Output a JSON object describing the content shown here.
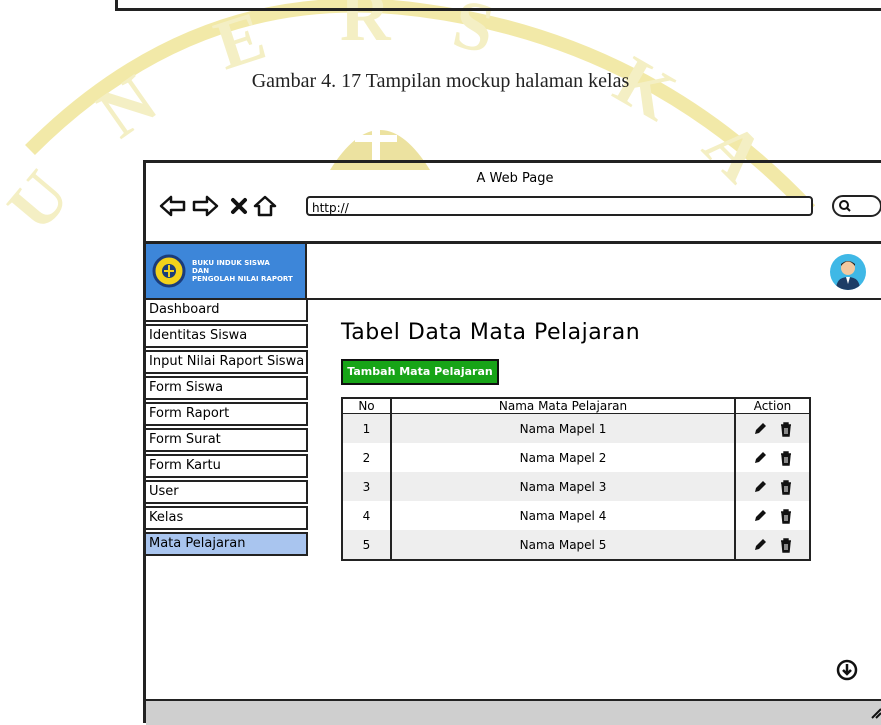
{
  "caption": "Gambar 4. 17 Tampilan mockup halaman kelas",
  "browser": {
    "title": "A Web Page",
    "url": "http://"
  },
  "app": {
    "logo_lines": [
      "BUKU INDUK SISWA",
      "DAN",
      "PENGOLAH NILAI RAPORT"
    ]
  },
  "sidebar": {
    "items": [
      {
        "label": "Dashboard"
      },
      {
        "label": "Identitas Siswa"
      },
      {
        "label": "Input Nilai Raport Siswa"
      },
      {
        "label": "Form Siswa"
      },
      {
        "label": "Form Raport"
      },
      {
        "label": "Form Surat"
      },
      {
        "label": "Form Kartu"
      },
      {
        "label": "User"
      },
      {
        "label": "Kelas"
      },
      {
        "label": "Mata Pelajaran",
        "active": true
      }
    ]
  },
  "main": {
    "title": "Tabel Data Mata Pelajaran",
    "add_button": "Tambah Mata Pelajaran",
    "table": {
      "headers": [
        "No",
        "Nama Mata Pelajaran",
        "Action"
      ],
      "rows": [
        {
          "no": "1",
          "name": "Nama Mapel 1"
        },
        {
          "no": "2",
          "name": "Nama Mapel 2"
        },
        {
          "no": "3",
          "name": "Nama Mapel 3"
        },
        {
          "no": "4",
          "name": "Nama Mapel 4"
        },
        {
          "no": "5",
          "name": "Nama Mapel 5"
        }
      ]
    }
  },
  "icons": {
    "back": "arrow-left-icon",
    "forward": "arrow-right-icon",
    "stop": "close-icon",
    "home": "home-icon",
    "search": "search-icon",
    "edit": "pencil-icon",
    "delete": "trash-icon",
    "scroll": "arrow-down-circle-icon"
  },
  "colors": {
    "logo_bg": "#3d86d9",
    "add_button": "#17a417",
    "active_item": "#a9c5ef",
    "avatar_bg": "#3fb8e6"
  }
}
